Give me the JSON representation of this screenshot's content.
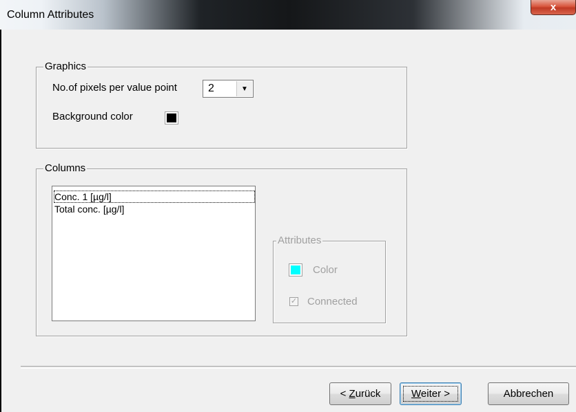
{
  "window": {
    "title": "Column Attributes",
    "close_glyph": "x"
  },
  "graphics": {
    "group_label": "Graphics",
    "pixels_label": "No.of pixels per value point",
    "pixels_value": "2",
    "background_label": "Background color",
    "background_color": "#000000"
  },
  "columns": {
    "group_label": "Columns",
    "items": [
      {
        "label": "Conc. 1 [µg/l]",
        "focused": true
      },
      {
        "label": "Total conc. [µg/l]",
        "focused": false
      }
    ],
    "attributes": {
      "group_label": "Attributes",
      "color_label": "Color",
      "color_value": "#00ffff",
      "connected_label": "Connected",
      "connected_checked": true
    }
  },
  "buttons": {
    "back_prefix": "< ",
    "back_mnemonic": "Z",
    "back_rest": "urück",
    "next_mnemonic": "W",
    "next_rest": "eiter >",
    "cancel_label": "Abbrechen"
  }
}
